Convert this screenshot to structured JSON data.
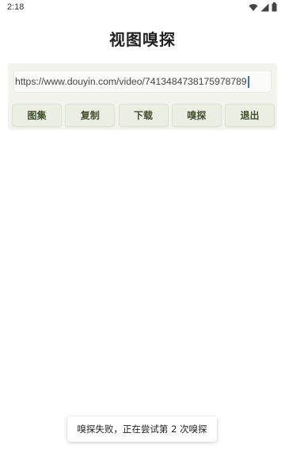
{
  "status_bar": {
    "time": "2:18",
    "icons": [
      "wifi-icon",
      "cellular-signal-icon",
      "battery-icon"
    ]
  },
  "header": {
    "title": "视图嗅探"
  },
  "url_input": {
    "value": "https://www.douyin.com/video/7413484738175978789"
  },
  "buttons": {
    "gallery": "图集",
    "copy": "复制",
    "download": "下载",
    "sniff": "嗅探",
    "exit": "退出"
  },
  "toast": {
    "message": "嗅探失败，正在尝试第 2 次嗅探"
  },
  "colors": {
    "card_background": "#f1f3ec",
    "button_background": "#eaeee3",
    "button_text": "#445030",
    "caret": "#3a6fd8"
  }
}
